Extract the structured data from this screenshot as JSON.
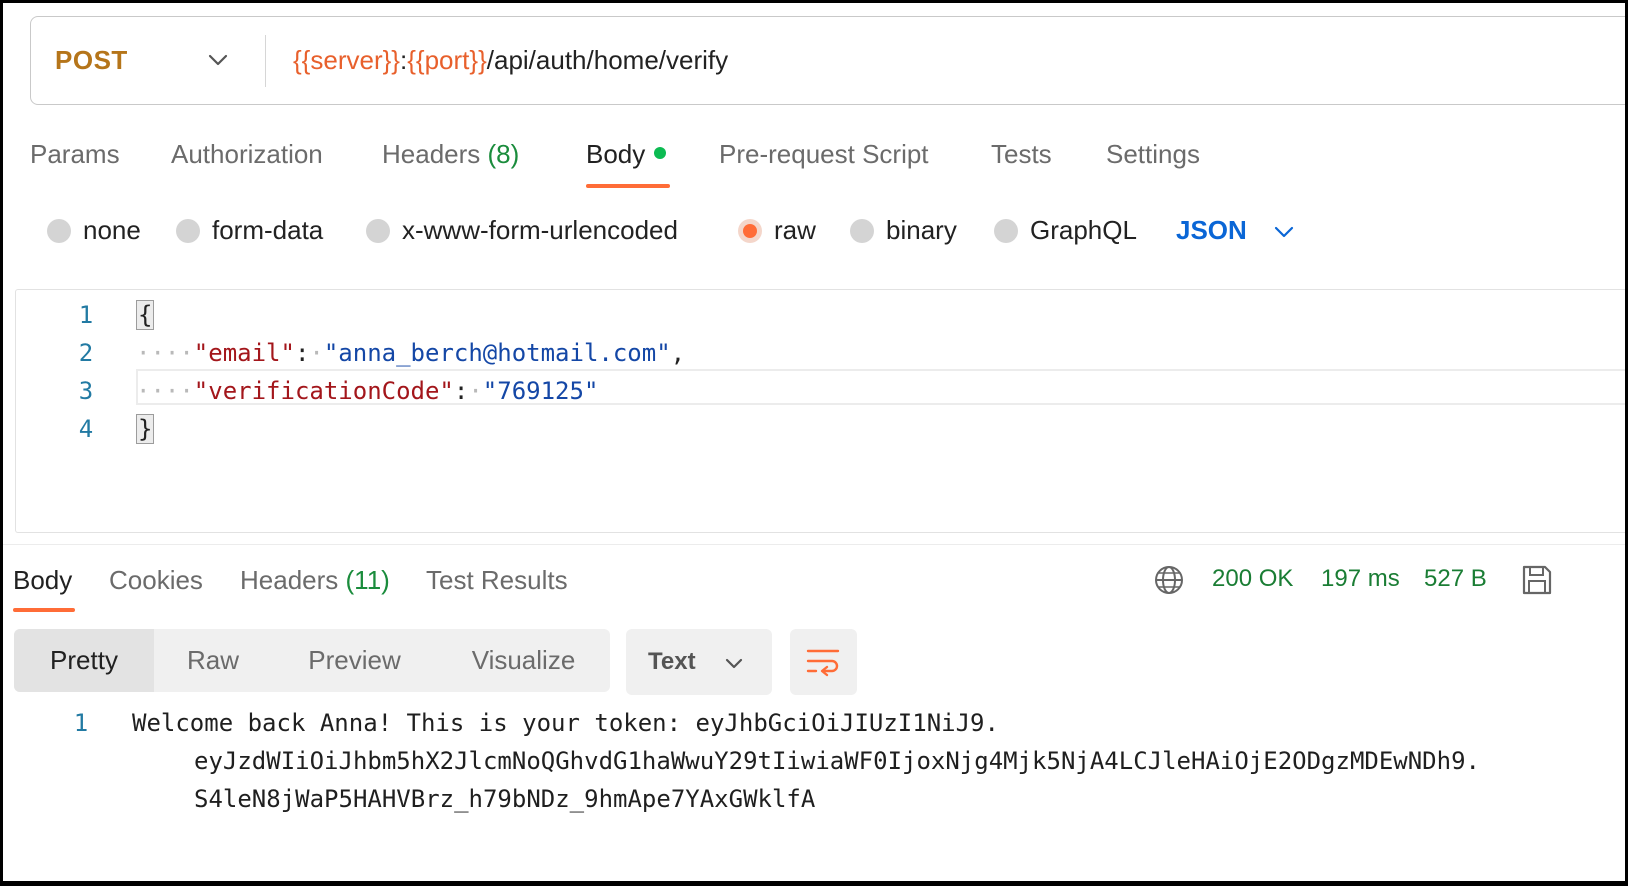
{
  "request": {
    "method": "POST",
    "url_server_var": "{{server}}",
    "url_sep": ":",
    "url_port_var": "{{port}}",
    "url_path": "/api/auth/home/verify"
  },
  "request_tabs": [
    {
      "label": "Params"
    },
    {
      "label": "Authorization"
    },
    {
      "label": "Headers",
      "count": "(8)"
    },
    {
      "label": "Body",
      "active": true
    },
    {
      "label": "Pre-request Script"
    },
    {
      "label": "Tests"
    },
    {
      "label": "Settings"
    }
  ],
  "body_types": [
    {
      "label": "none"
    },
    {
      "label": "form-data"
    },
    {
      "label": "x-www-form-urlencoded"
    },
    {
      "label": "raw",
      "selected": true
    },
    {
      "label": "binary"
    },
    {
      "label": "GraphQL"
    }
  ],
  "language": "JSON",
  "editor": {
    "line_numbers": [
      "1",
      "2",
      "3",
      "4"
    ],
    "open_brace": "{",
    "close_brace": "}",
    "indent": "····",
    "email_key": "\"email\"",
    "email_value": "\"anna_berch@hotmail.com\"",
    "code_key": "\"verificationCode\"",
    "code_value": "\"769125\"",
    "colon": ":",
    "comma": ","
  },
  "response_tabs": [
    {
      "label": "Body",
      "active": true
    },
    {
      "label": "Cookies"
    },
    {
      "label": "Headers",
      "count": "(11)"
    },
    {
      "label": "Test Results"
    }
  ],
  "response_meta": {
    "status": "200 OK",
    "time": "197 ms",
    "size": "527 B"
  },
  "view_modes": [
    "Pretty",
    "Raw",
    "Preview",
    "Visualize"
  ],
  "format": "Text",
  "response_body": {
    "line_number": "1",
    "lines": [
      "Welcome back Anna! This is your token: eyJhbGciOiJIUzI1NiJ9.",
      "eyJzdWIiOiJhbm5hX2JlcmNoQGhvdG1haWwuY29tIiwiaWF0IjoxNjg4Mjk5NjA4LCJleHAiOjE2ODgzMDEwNDh9.",
      "S4leN8jWaP5HAHVBrz_h79bNDz_9hmApe7YAxGWklfA"
    ]
  },
  "colors": {
    "accent": "#ff6c37",
    "method": "#b5751a",
    "status_green": "#1a7d34",
    "link_blue": "#0a66d6"
  },
  "icons": [
    "chevron-down-icon",
    "globe-icon",
    "save-icon",
    "wrap-lines-icon"
  ]
}
